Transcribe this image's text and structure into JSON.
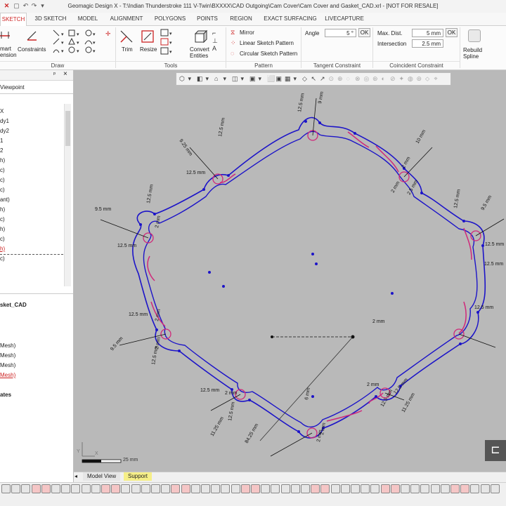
{
  "window": {
    "title": "Geomagic Design X - T:\\Indian Thunderstroke 111 V-Twin\\BXXXX\\CAD Outgoing\\Cam Cover\\Cam Cover and Gasket_CAD.xrl - [NOT FOR RESALE]"
  },
  "menu": {
    "tabs": [
      "SKETCH",
      "3D SKETCH",
      "MODEL",
      "ALIGNMENT",
      "POLYGONS",
      "POINTS",
      "REGION",
      "EXACT SURFACING",
      "LIVECAPTURE"
    ]
  },
  "ribbon": {
    "draw": {
      "label": "Draw",
      "smart_dimension": "mart\nension",
      "smart_dimension_line1": "mart",
      "smart_dimension_line2": "ension",
      "constraints": "Constraints"
    },
    "tools": {
      "label": "Tools",
      "trim": "Trim",
      "resize": "Resize",
      "convert_line1": "Convert",
      "convert_line2": "Entities"
    },
    "pattern": {
      "label": "Pattern",
      "mirror": "Mirror",
      "linear": "Linear Sketch Pattern",
      "circular": "Circular Sketch Pattern"
    },
    "tangent": {
      "label": "Tangent Constraint",
      "angle_label": "Angle",
      "angle_value": "5 °",
      "ok": "OK"
    },
    "coincident": {
      "label": "Coincident Constraint",
      "maxdist_label": "Max. Dist.",
      "maxdist_value": "5 mm",
      "intersection_label": "Intersection",
      "intersection_value": "2.5 mm",
      "ok": "OK"
    },
    "rebuild": {
      "line1": "Rebuild",
      "line2": "Spline"
    }
  },
  "left_panel": {
    "header_pin": "ᵖ",
    "header_close": "×",
    "title": "Viewpoint",
    "tree_items": [
      {
        "text": "X",
        "color": "#222",
        "bold": false
      },
      {
        "text": "dy1",
        "color": "#222",
        "bold": false
      },
      {
        "text": "dy2",
        "color": "#222",
        "bold": false
      },
      {
        "text": "1",
        "color": "#222",
        "bold": false
      },
      {
        "text": "2",
        "color": "#222",
        "bold": false
      },
      {
        "text": "h)",
        "color": "#222",
        "bold": false
      },
      {
        "text": "c)",
        "color": "#222",
        "bold": false
      },
      {
        "text": "c)",
        "color": "#222",
        "bold": false
      },
      {
        "text": "c)",
        "color": "#222",
        "bold": false
      },
      {
        "text": "ant)",
        "color": "#222",
        "bold": false
      },
      {
        "text": "h)",
        "color": "#222",
        "bold": false
      },
      {
        "text": "c)",
        "color": "#222",
        "bold": false
      },
      {
        "text": "h)",
        "color": "#222",
        "bold": false
      },
      {
        "text": "c)",
        "color": "#222",
        "bold": false
      },
      {
        "text": "h)",
        "color": "#c22",
        "bold": false
      },
      {
        "text": "c)",
        "color": "#222",
        "bold": false
      }
    ],
    "lower_items": [
      {
        "text": "sket_CAD",
        "color": "#222",
        "bold": true
      },
      {
        "text": "Mesh)",
        "color": "#222",
        "bold": false
      },
      {
        "text": "Mesh)",
        "color": "#222",
        "bold": false
      },
      {
        "text": "Mesh)",
        "color": "#222",
        "bold": false
      },
      {
        "text": "Mesh)",
        "color": "#c22",
        "bold": false
      },
      {
        "text": "ates",
        "color": "#222",
        "bold": true
      }
    ]
  },
  "viewport": {
    "scale_label": "25 mm",
    "dimensions": [
      {
        "text": "9 mm"
      },
      {
        "text": "12.5 mm"
      },
      {
        "text": "12.5 mm"
      },
      {
        "text": "9.25 mm"
      },
      {
        "text": "12.5 mm"
      },
      {
        "text": "12.5 mm"
      },
      {
        "text": "2 mm"
      },
      {
        "text": "9.5 mm"
      },
      {
        "text": "12.5 mm"
      },
      {
        "text": "10 mm"
      },
      {
        "text": "2 mm"
      },
      {
        "text": "2.5 mm"
      },
      {
        "text": "2 mm"
      },
      {
        "text": "12.5 mm"
      },
      {
        "text": "9.5 mm"
      },
      {
        "text": "12.5 mm"
      },
      {
        "text": "12.5 mm"
      },
      {
        "text": "12.5 mm"
      },
      {
        "text": "2 mm"
      },
      {
        "text": "9.5 mm"
      },
      {
        "text": "12.5 mm"
      },
      {
        "text": "2 mm"
      },
      {
        "text": "12.5 mm"
      },
      {
        "text": "2 mm"
      },
      {
        "text": "11.25 mm"
      },
      {
        "text": "12.5 mm"
      },
      {
        "text": "84.25 mm"
      },
      {
        "text": "2 mm"
      },
      {
        "text": "12.5 mm"
      },
      {
        "text": "11.25 mm"
      },
      {
        "text": "12.5 mm"
      },
      {
        "text": "2 mm"
      },
      {
        "text": "2 mm"
      },
      {
        "text": "12.5 mm"
      },
      {
        "text": "6 mm"
      },
      {
        "text": "2 mm"
      }
    ]
  },
  "bottom_tabs": {
    "model_view": "Model View",
    "support": "Support"
  },
  "colors": {
    "accent": "#c22222",
    "sketch_blue": "#1c14c8",
    "sketch_magenta": "#d0287a",
    "viewport_bg": "#b9b9b9"
  }
}
